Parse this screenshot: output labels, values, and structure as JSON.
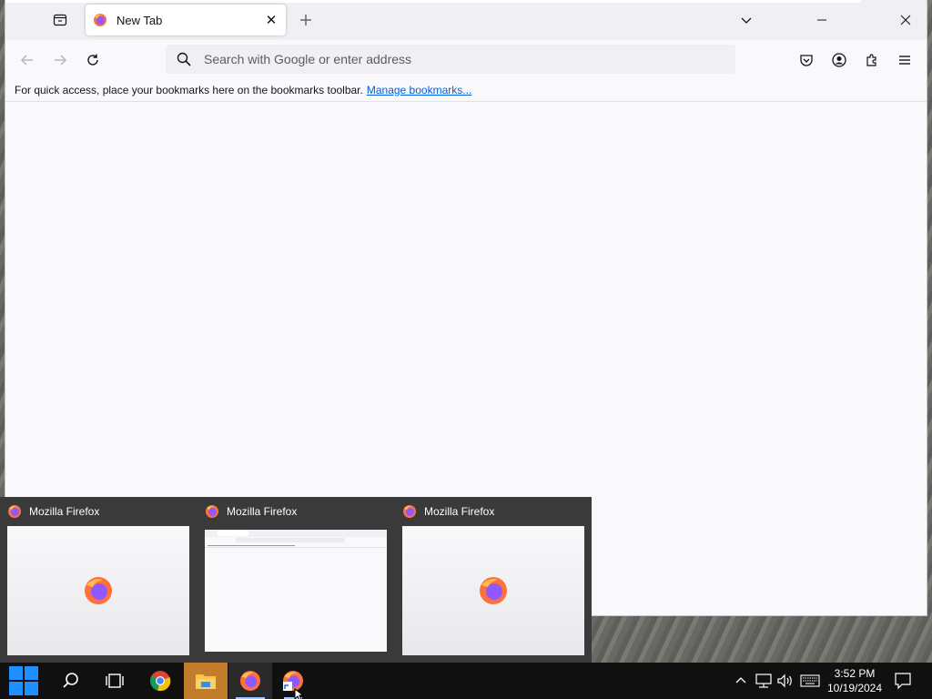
{
  "browser": {
    "tab": {
      "title": "New Tab"
    },
    "urlbar": {
      "placeholder": "Search with Google or enter address"
    },
    "bookmarks_bar": {
      "message": "For quick access, place your bookmarks here on the bookmarks toolbar.",
      "link": "Manage bookmarks..."
    }
  },
  "previews": [
    {
      "title": "Mozilla Firefox"
    },
    {
      "title": "Mozilla Firefox"
    },
    {
      "title": "Mozilla Firefox"
    }
  ],
  "taskbar": {
    "time": "3:52 PM",
    "date": "10/19/2024",
    "apps": [
      "start-icon",
      "search-icon",
      "task-view-icon",
      "chrome-icon",
      "file-explorer-icon",
      "firefox-icon",
      "firefox-shortcut-icon"
    ]
  },
  "colors": {
    "accent_link": "#0061e0",
    "taskbar": "#101010",
    "preview_panel": "#3a3a3a"
  }
}
